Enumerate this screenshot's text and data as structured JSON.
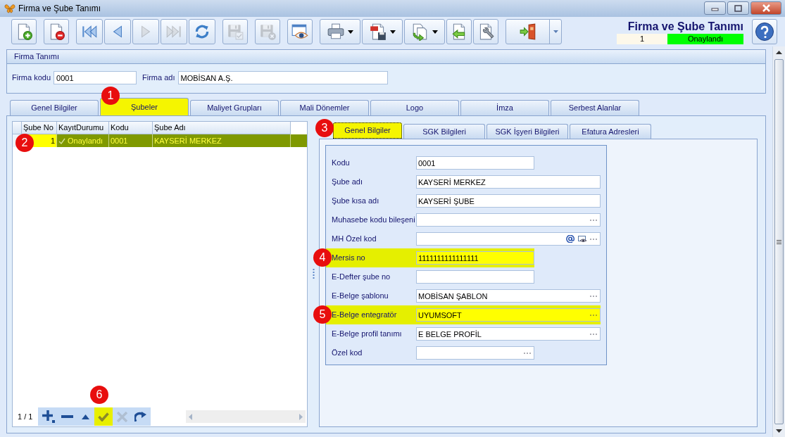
{
  "window": {
    "title": "Firma ve Şube Tanımı"
  },
  "toolbar": {
    "groups": [
      [
        {
          "kind": "new",
          "disabled": false,
          "dropdown": false
        }
      ],
      [
        {
          "kind": "delete",
          "disabled": false,
          "dropdown": false
        }
      ],
      [
        {
          "kind": "first",
          "disabled": false,
          "dropdown": false
        },
        {
          "kind": "previous",
          "disabled": false,
          "dropdown": false
        },
        {
          "kind": "next",
          "disabled": true,
          "dropdown": false
        },
        {
          "kind": "last",
          "disabled": true,
          "dropdown": false
        },
        {
          "kind": "refresh",
          "disabled": false,
          "dropdown": false
        }
      ],
      [
        {
          "kind": "save",
          "disabled": true,
          "dropdown": false
        }
      ],
      [
        {
          "kind": "save_cancel",
          "disabled": true,
          "dropdown": false
        }
      ],
      [
        {
          "kind": "preview",
          "disabled": false,
          "dropdown": false
        }
      ],
      [
        {
          "kind": "print",
          "disabled": false,
          "dropdown": true
        },
        {
          "kind": "pdf",
          "disabled": false,
          "dropdown": true
        },
        {
          "kind": "export",
          "disabled": false,
          "dropdown": true
        },
        {
          "kind": "import",
          "disabled": false,
          "dropdown": false
        },
        {
          "kind": "settings",
          "disabled": false,
          "dropdown": false
        }
      ],
      [
        {
          "kind": "exit",
          "disabled": false,
          "dropdown": true
        }
      ]
    ]
  },
  "header": {
    "title": "Firma ve Şube Tanımı",
    "record": "1",
    "status": "Onaylandı"
  },
  "company": {
    "title": "Firma Tanımı",
    "fields": [
      {
        "label": "Firma kodu",
        "value": "0001"
      },
      {
        "label": "Firma adı",
        "value": "MOBİSAN A.Ş."
      }
    ]
  },
  "tabs": [
    {
      "label": "Genel Bilgiler",
      "selected": false
    },
    {
      "label": "Şubeler",
      "selected": true,
      "marker": "1"
    },
    {
      "label": "Maliyet Grupları",
      "selected": false
    },
    {
      "label": "Mali Dönemler",
      "selected": false
    },
    {
      "label": "Logo",
      "selected": false
    },
    {
      "label": "İmza",
      "selected": false
    },
    {
      "label": "Serbest Alanlar",
      "selected": false
    }
  ],
  "branches": {
    "columns": [
      "Şube No",
      "KayıtDurumu",
      "Kodu",
      "Şube Adı"
    ],
    "rows": [
      {
        "selected": true,
        "marker": "2",
        "approved": true,
        "cells": [
          {
            "text": "1",
            "focused": true
          },
          {
            "text": "Onaylandı",
            "focused": false
          },
          {
            "text": "0001",
            "focused": false
          },
          {
            "text": "KAYSERİ MERKEZ",
            "focused": false
          }
        ]
      }
    ],
    "navigator": {
      "position": "1 / 1",
      "buttons": [
        {
          "kind": "add",
          "disabled": false,
          "highlighted": false
        },
        {
          "kind": "remove",
          "disabled": false,
          "highlighted": false
        },
        {
          "kind": "up",
          "disabled": false,
          "highlighted": false
        },
        {
          "kind": "confirm",
          "disabled": false,
          "highlighted": true,
          "marker": "6"
        },
        {
          "kind": "cancel",
          "disabled": true,
          "highlighted": false
        },
        {
          "kind": "redo",
          "disabled": false,
          "highlighted": false
        }
      ]
    }
  },
  "subtabs": [
    {
      "label": "Genel Bilgiler",
      "selected": true,
      "marker": "3"
    },
    {
      "label": "SGK Bilgileri",
      "selected": false
    },
    {
      "label": "SGK İşyeri Bilgileri",
      "selected": false
    },
    {
      "label": "Efatura Adresleri",
      "selected": false
    }
  ],
  "form": [
    {
      "label": "Kodu",
      "value": "0001",
      "kind": "short",
      "highlighted": false
    },
    {
      "label": "Şube adı",
      "value": "KAYSERİ MERKEZ",
      "kind": "long",
      "highlighted": false
    },
    {
      "label": "Şube kısa adı",
      "value": "KAYSERİ ŞUBE",
      "kind": "long",
      "highlighted": false
    },
    {
      "label": "Muhasebe kodu bileşeni",
      "kind": "long",
      "buttons": [
        {
          "kind": "more"
        }
      ],
      "highlighted": false
    },
    {
      "label": "MH Özel kod",
      "kind": "long",
      "buttons": [
        {
          "kind": "at"
        },
        {
          "kind": "preview"
        },
        {
          "kind": "more"
        }
      ],
      "highlighted": false
    },
    {
      "label": "Mersis no",
      "value": "1111111111111111",
      "kind": "short",
      "highlighted": true,
      "marker": "4"
    },
    {
      "label": "E-Defter şube no",
      "kind": "short",
      "highlighted": false
    },
    {
      "label": "E-Belge şablonu",
      "value": "MOBİSAN ŞABLON",
      "kind": "long",
      "buttons": [
        {
          "kind": "more"
        }
      ],
      "highlighted": false
    },
    {
      "label": "E-Belge entegratör",
      "value": "UYUMSOFT",
      "kind": "long",
      "buttons": [
        {
          "kind": "more"
        }
      ],
      "highlighted": true,
      "marker": "5"
    },
    {
      "label": "E-Belge profil tanımı",
      "value": "E BELGE PROFİL",
      "kind": "long",
      "buttons": [
        {
          "kind": "more"
        }
      ],
      "highlighted": false
    },
    {
      "label": "Özel kod",
      "kind": "short",
      "buttons": [
        {
          "kind": "more"
        }
      ],
      "highlighted": false
    }
  ]
}
